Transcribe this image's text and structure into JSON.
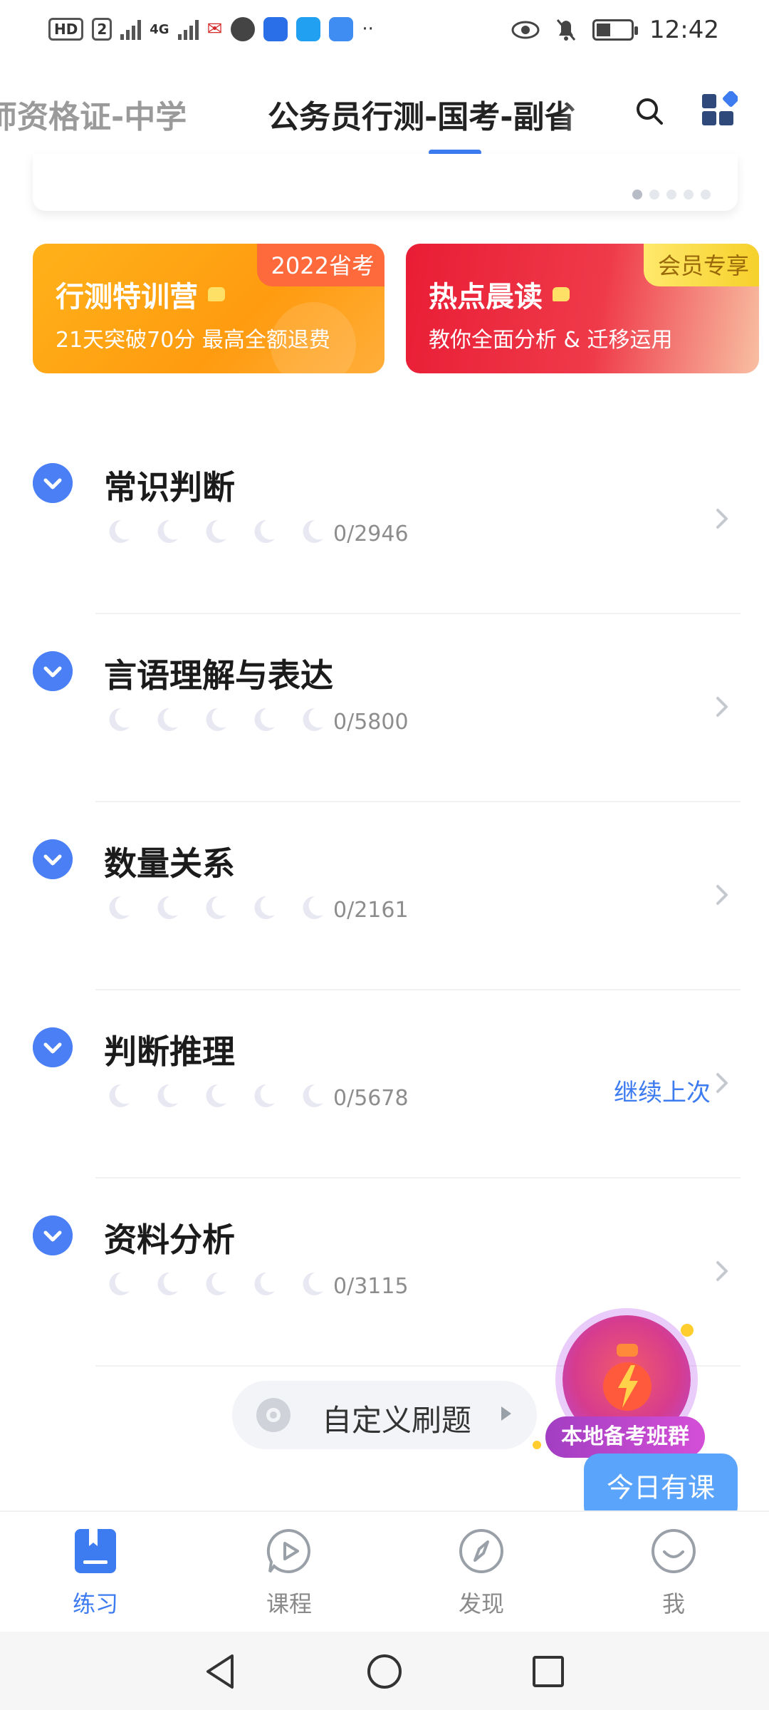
{
  "status_bar": {
    "hd_label": "HD",
    "sim_label": "2",
    "network_label": "4G",
    "time": "12:42"
  },
  "top_tabs": [
    {
      "label": "师资格证-中学",
      "active": false
    },
    {
      "label": "公务员行测-国考-副省",
      "active": true
    }
  ],
  "banner": {
    "dots": [
      true,
      false,
      false,
      false,
      false
    ]
  },
  "promos": [
    {
      "title": "行测特训营",
      "subtitle": "21天突破70分 最高全额退费",
      "badge": "2022省考"
    },
    {
      "title": "热点晨读",
      "subtitle": "教你全面分析 & 迁移运用",
      "badge": "会员专享"
    }
  ],
  "categories": [
    {
      "name": "常识判断",
      "progress": "0/2946",
      "continue_label": ""
    },
    {
      "name": "言语理解与表达",
      "progress": "0/5800",
      "continue_label": ""
    },
    {
      "name": "数量关系",
      "progress": "0/2161",
      "continue_label": ""
    },
    {
      "name": "判断推理",
      "progress": "0/5678",
      "continue_label": "继续上次"
    },
    {
      "name": "资料分析",
      "progress": "0/3115",
      "continue_label": ""
    }
  ],
  "custom_practice": {
    "label": "自定义刷题"
  },
  "floating": {
    "group_label": "本地备考班群",
    "today_label": "今日有课"
  },
  "bottom_nav": [
    {
      "label": "练习",
      "icon": "book-icon",
      "active": true
    },
    {
      "label": "课程",
      "icon": "play-bubble-icon",
      "active": false
    },
    {
      "label": "发现",
      "icon": "compass-icon",
      "active": false
    },
    {
      "label": "我",
      "icon": "profile-icon",
      "active": false
    }
  ],
  "colors": {
    "accent": "#3d7bf0",
    "toggle_blue": "#4a7ff5",
    "promo_orange": "#ffa514",
    "promo_red": "#e91d35",
    "bubble_blue": "#5ba4fb"
  }
}
